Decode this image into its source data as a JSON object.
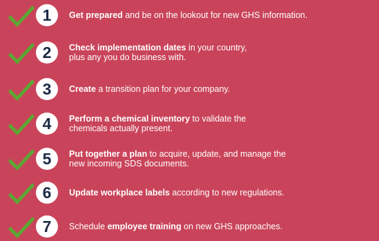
{
  "colors": {
    "background": "#c9445a",
    "check": "#5aa832",
    "number_circle": "#ffffff",
    "number_text": "#1d2b45",
    "text": "#ffffff"
  },
  "icons": {
    "check": "checkmark-icon"
  },
  "steps": [
    {
      "number": "1",
      "bold": "Get prepared",
      "rest": " and be on the lookout for new GHS information.",
      "line2": ""
    },
    {
      "number": "2",
      "bold": "Check implementation dates",
      "rest": " in your country,",
      "line2": "plus any you do business with."
    },
    {
      "number": "3",
      "bold": "Create",
      "rest": " a transition plan for your company.",
      "line2": ""
    },
    {
      "number": "4",
      "bold": "Perform a chemical inventory",
      "rest": " to validate the",
      "line2": "chemicals actually present."
    },
    {
      "number": "5",
      "bold": "Put together a plan",
      "rest": " to acquire, update, and manage the",
      "line2": "new incoming SDS documents."
    },
    {
      "number": "6",
      "bold": "Update workplace labels",
      "rest": " according to new regulations.",
      "line2": ""
    },
    {
      "number": "7",
      "pre": "Schedule ",
      "bold": "employee training",
      "rest": " on new GHS approaches.",
      "line2": ""
    }
  ]
}
